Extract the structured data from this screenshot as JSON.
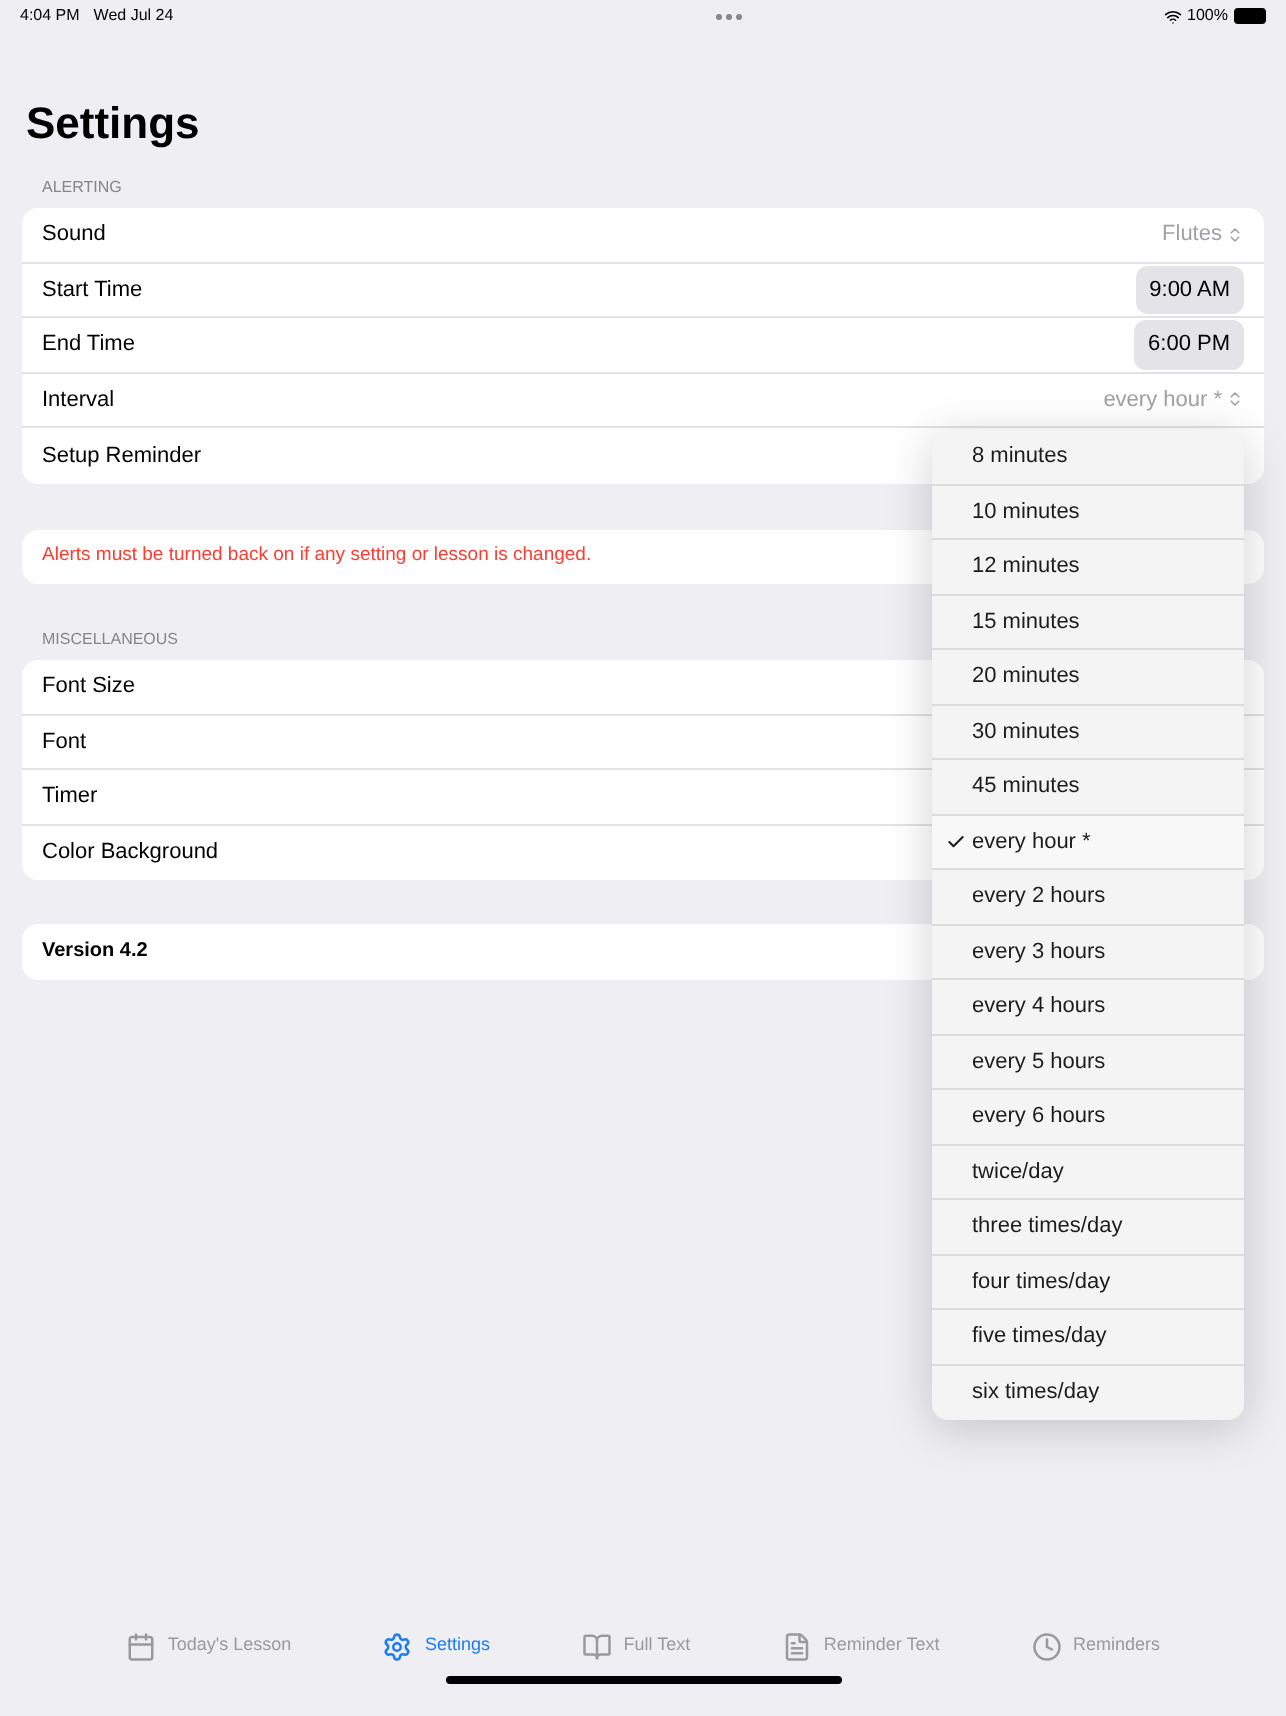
{
  "status_bar": {
    "time": "4:04 PM",
    "date": "Wed Jul 24",
    "battery": "100%"
  },
  "title": "Settings",
  "alerting": {
    "header": "ALERTING",
    "rows": [
      {
        "kind": "picker",
        "label": "Sound",
        "value": "Flutes"
      },
      {
        "kind": "time",
        "label": "Start Time",
        "value": "9:00 AM"
      },
      {
        "kind": "time",
        "label": "End Time",
        "value": "6:00 PM"
      },
      {
        "kind": "picker",
        "label": "Interval",
        "value": "every hour *"
      },
      {
        "kind": "plain",
        "label": "Setup Reminder"
      }
    ]
  },
  "notice": "Alerts must be turned back on if any setting or lesson is changed.",
  "misc": {
    "header": "MISCELLANEOUS",
    "rows": [
      {
        "label": "Font Size"
      },
      {
        "label": "Font"
      },
      {
        "label": "Timer"
      },
      {
        "label": "Color Background"
      }
    ]
  },
  "version": "Version 4.2",
  "menu": [
    {
      "label": "8 minutes",
      "selected": false
    },
    {
      "label": "10 minutes",
      "selected": false
    },
    {
      "label": "12 minutes",
      "selected": false
    },
    {
      "label": "15 minutes",
      "selected": false
    },
    {
      "label": "20 minutes",
      "selected": false
    },
    {
      "label": "30 minutes",
      "selected": false
    },
    {
      "label": "45 minutes",
      "selected": false
    },
    {
      "label": "every hour *",
      "selected": true
    },
    {
      "label": "every 2 hours",
      "selected": false
    },
    {
      "label": "every 3 hours",
      "selected": false
    },
    {
      "label": "every 4 hours",
      "selected": false
    },
    {
      "label": "every 5 hours",
      "selected": false
    },
    {
      "label": "every 6 hours",
      "selected": false
    },
    {
      "label": "twice/day",
      "selected": false
    },
    {
      "label": "three times/day",
      "selected": false
    },
    {
      "label": "four times/day",
      "selected": false
    },
    {
      "label": "five times/day",
      "selected": false
    },
    {
      "label": "six times/day",
      "selected": false
    }
  ],
  "tabs": [
    {
      "kind": "calendar",
      "label": "Today's Lesson",
      "selected": false
    },
    {
      "kind": "gear",
      "label": "Settings",
      "selected": true
    },
    {
      "kind": "book",
      "label": "Full Text",
      "selected": false
    },
    {
      "kind": "document",
      "label": "Reminder Text",
      "selected": false
    },
    {
      "kind": "clock",
      "label": "Reminders",
      "selected": false
    }
  ]
}
